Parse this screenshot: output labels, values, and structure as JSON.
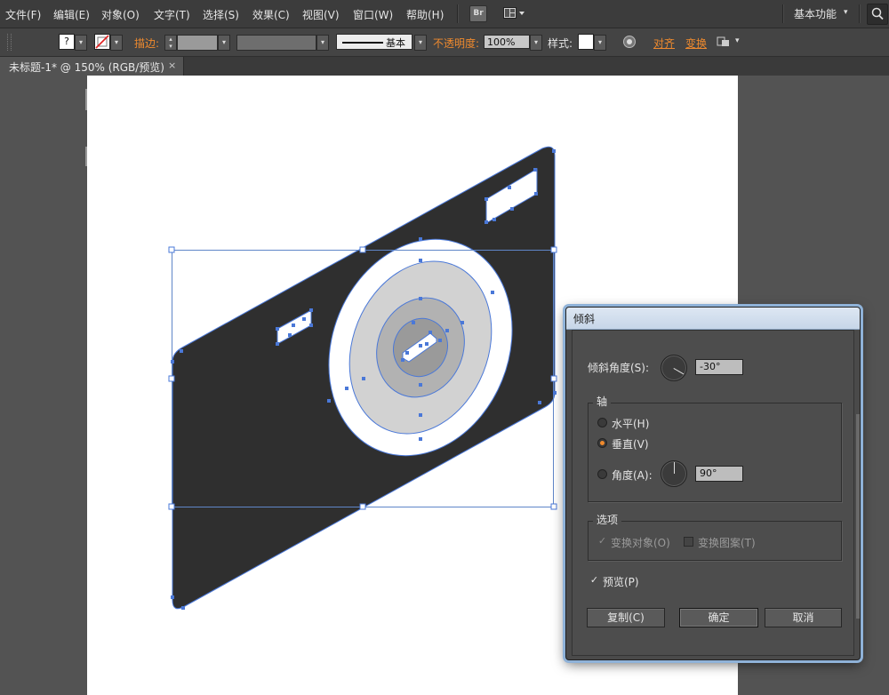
{
  "menubar": {
    "items": [
      "文件(F)",
      "编辑(E)",
      "对象(O)",
      "文字(T)",
      "选择(S)",
      "效果(C)",
      "视图(V)",
      "窗口(W)",
      "帮助(H)"
    ],
    "bridge_label": "Br",
    "workspace_label": "基本功能",
    "layout_icon": "arrange-documents-icon",
    "search_icon": "search-icon"
  },
  "controlbar": {
    "fill_swatch_label": "?",
    "stroke_label": "描边:",
    "stroke_profile": "基本",
    "opacity_label": "不透明度:",
    "opacity_value": "100%",
    "style_label": "样式:",
    "align_label": "对齐",
    "transform_label": "变换",
    "accent_color": "#ef8a2e"
  },
  "tab": {
    "title": "未标题-1* @ 150% (RGB/预览)",
    "close": "×"
  },
  "dialog": {
    "title": "倾斜",
    "shear_angle_label": "倾斜角度(S):",
    "shear_angle_value": "-30°",
    "axis_group": "轴",
    "axis_options": [
      "水平(H)",
      "垂直(V)",
      "角度(A):"
    ],
    "axis_selected": "垂直(V)",
    "axis_angle_value": "90°",
    "options_group": "选项",
    "transform_objects": "变换对象(O)",
    "transform_patterns": "变换图案(T)",
    "preview": "预览(P)",
    "copy_button": "复制(C)",
    "ok_button": "确定",
    "cancel_button": "取消"
  },
  "colors": {
    "camera_body": "#2f2f2f",
    "lens_ring_outer": "#ffffff",
    "lens_ring_mid": "#d2d2d2",
    "lens_ring_inner": "#b2b2b2",
    "selection": "#4a78d8"
  }
}
